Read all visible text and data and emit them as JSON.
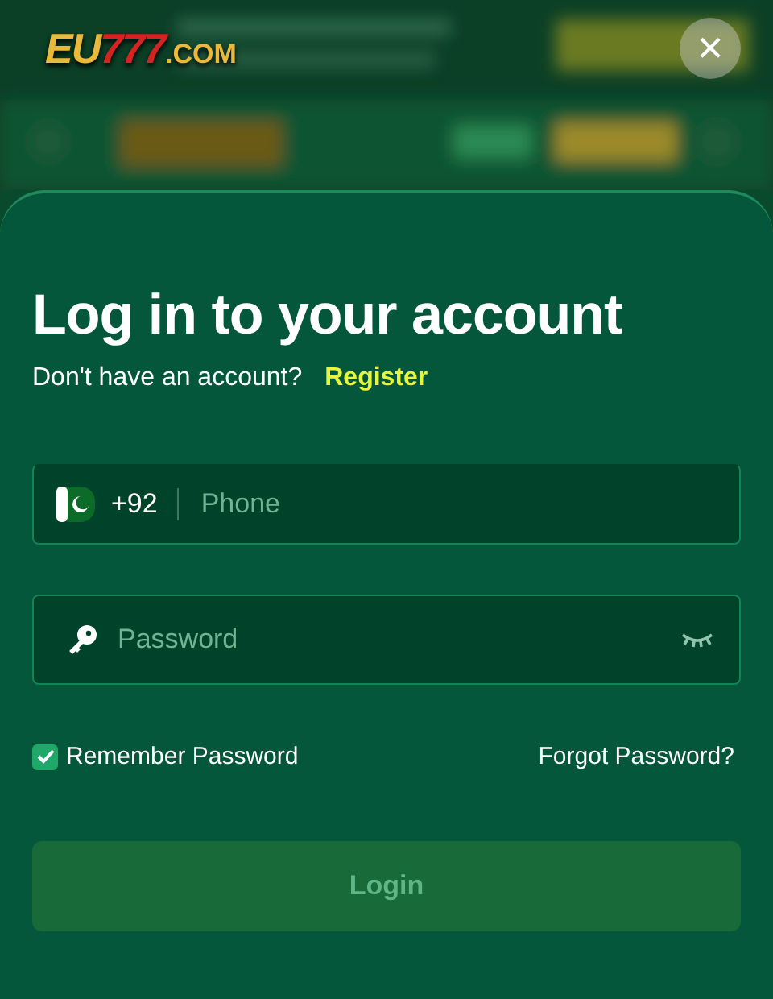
{
  "header": {
    "logo": {
      "prefix": "EU",
      "digits": "777",
      "suffix": ".COM"
    },
    "close": "×"
  },
  "login": {
    "title": "Log in to your account",
    "prompt": "Don't have an account?",
    "register_link": "Register",
    "phone": {
      "country_code": "+92",
      "placeholder": "Phone"
    },
    "password": {
      "placeholder": "Password",
      "visible": false
    },
    "remember": {
      "label": "Remember Password",
      "checked": true
    },
    "forgot_link": "Forgot Password?",
    "submit": {
      "label": "Login",
      "disabled": true
    }
  }
}
